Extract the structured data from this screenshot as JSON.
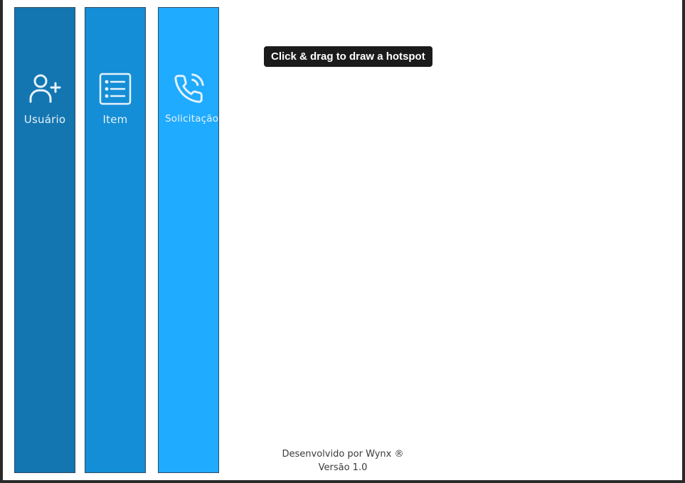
{
  "tiles": [
    {
      "label": "Usuário",
      "icon": "user-add-icon",
      "color": "#1376b1"
    },
    {
      "label": "Item",
      "icon": "list-icon",
      "color": "#148ed6"
    },
    {
      "label": "Solicitação",
      "icon": "phone-icon",
      "color": "#1fabff"
    }
  ],
  "tooltip": {
    "text": "Click & drag to draw a hotspot"
  },
  "footer": {
    "developer": "Desenvolvido por Wynx ®",
    "version": "Versão 1.0"
  },
  "colors": {
    "tile_border": "#2c4a63",
    "tooltip_bg": "#1b1b1b"
  }
}
